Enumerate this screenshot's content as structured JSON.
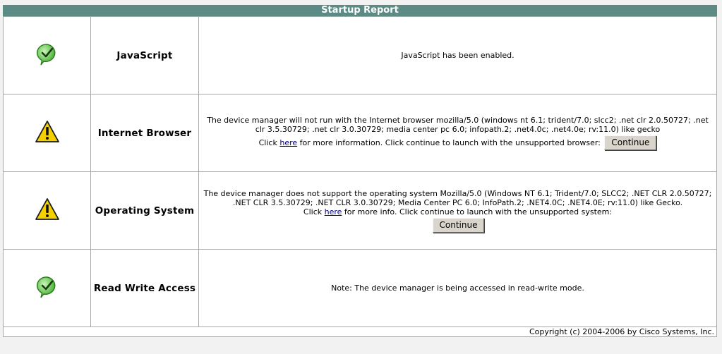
{
  "title": "Startup Report",
  "rows": [
    {
      "status": "ok",
      "icon": "check-icon",
      "name": "JavaScript",
      "message": "JavaScript has been enabled."
    },
    {
      "status": "warning",
      "icon": "warning-icon",
      "name": "Internet Browser",
      "message_line1": "The device manager will not run with the Internet browser mozilla/5.0 (windows nt 6.1; trident/7.0; slcc2; .net clr 2.0.50727; .net clr 3.5.30729; .net clr 3.0.30729; media center pc 6.0; infopath.2; .net4.0c; .net4.0e; rv:11.0) like gecko",
      "click_prefix": "Click ",
      "link_label": "here",
      "click_suffix": " for more information. Click continue to launch with the unsupported browser:",
      "button_label": "Continue"
    },
    {
      "status": "warning",
      "icon": "warning-icon",
      "name": "Operating System",
      "message_line1": "The device manager does not support the operating system Mozilla/5.0 (Windows NT 6.1; Trident/7.0; SLCC2; .NET CLR 2.0.50727; .NET CLR 3.5.30729; .NET CLR 3.0.30729; Media Center PC 6.0; InfoPath.2; .NET4.0C; .NET4.0E; rv:11.0) like Gecko.",
      "click_prefix": "Click ",
      "link_label": "here",
      "click_suffix": " for more info. Click continue to launch with the unsupported system:",
      "button_label": "Continue"
    },
    {
      "status": "ok",
      "icon": "check-icon",
      "name": "Read Write Access",
      "message": "Note: The device manager is being accessed in read-write mode."
    }
  ],
  "footer": "Copyright (c) 2004-2006 by Cisco Systems, Inc.",
  "colors": {
    "title_bar": "#5b8b84",
    "check_green": "#7fd36a",
    "warning_yellow": "#f5d000"
  }
}
